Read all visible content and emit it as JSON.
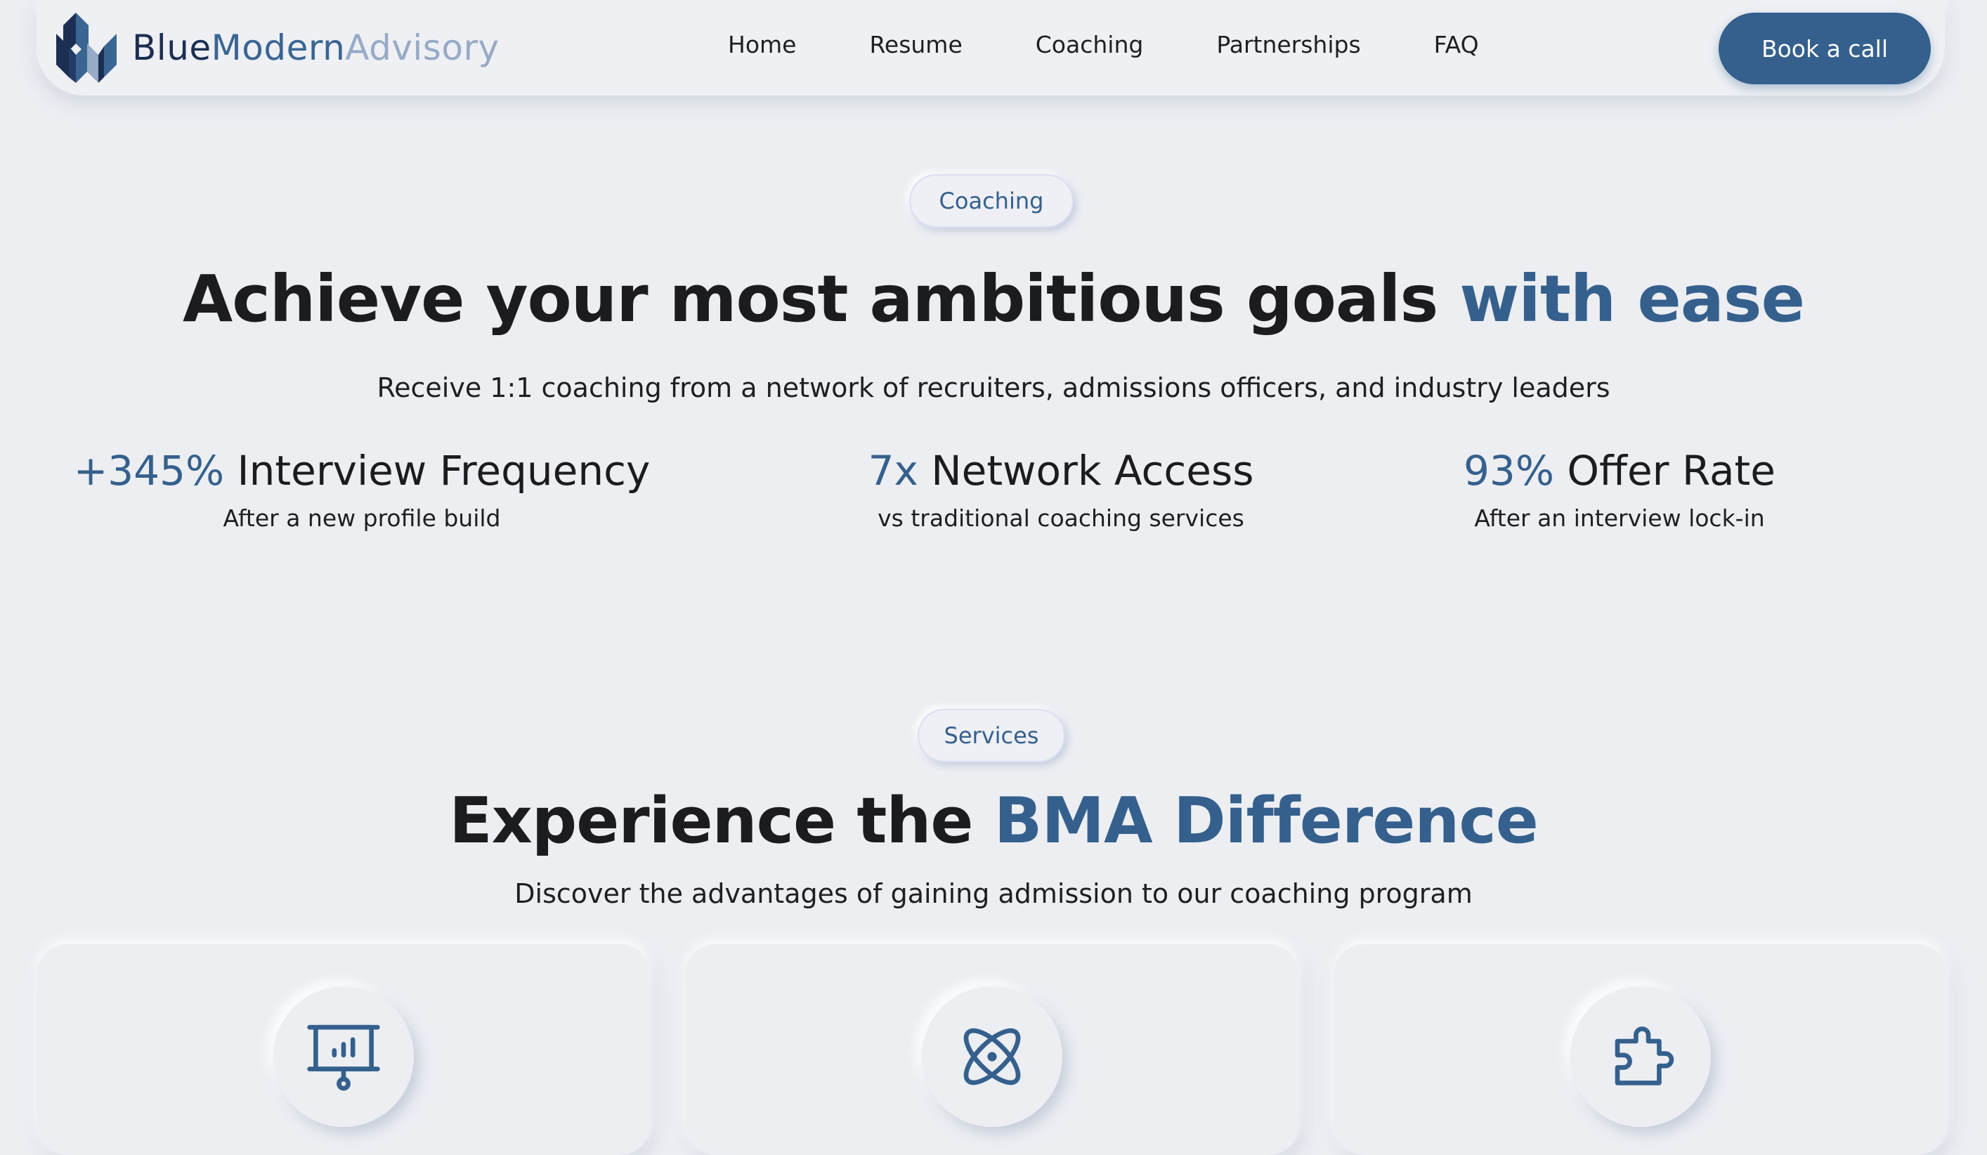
{
  "brand": {
    "part1": "Blue",
    "part2": "Modern",
    "part3": "Advisory",
    "colors": {
      "dark": "#1c2f52",
      "mid": "#3a6593",
      "light": "#97aac6"
    }
  },
  "nav": {
    "items": [
      {
        "label": "Home"
      },
      {
        "label": "Resume"
      },
      {
        "label": "Coaching"
      },
      {
        "label": "Partnerships"
      },
      {
        "label": "FAQ"
      }
    ],
    "cta_label": "Book a call"
  },
  "hero": {
    "pill": "Coaching",
    "title_main": "Achieve your most ambitious goals ",
    "title_accent": "with ease",
    "subtitle": "Receive 1:1 coaching from a network of recruiters, admissions officers, and industry leaders"
  },
  "stats": [
    {
      "value": "+345%",
      "label": " Interview Frequency",
      "caption": "After a new profile build"
    },
    {
      "value": "7x",
      "label": " Network Access",
      "caption": "vs traditional coaching services"
    },
    {
      "value": "93%",
      "label": " Offer Rate",
      "caption": "After an interview lock-in"
    }
  ],
  "services": {
    "pill": "Services",
    "title_main": "Experience the ",
    "title_accent": "BMA Difference",
    "subtitle": "Discover the advantages of gaining admission to our coaching program",
    "cards": [
      {
        "icon": "presentation-chart-icon"
      },
      {
        "icon": "atom-icon"
      },
      {
        "icon": "puzzle-piece-icon"
      }
    ]
  },
  "theme": {
    "accent": "#35608d",
    "background": "#eceef2",
    "text": "#1c1c1e"
  }
}
